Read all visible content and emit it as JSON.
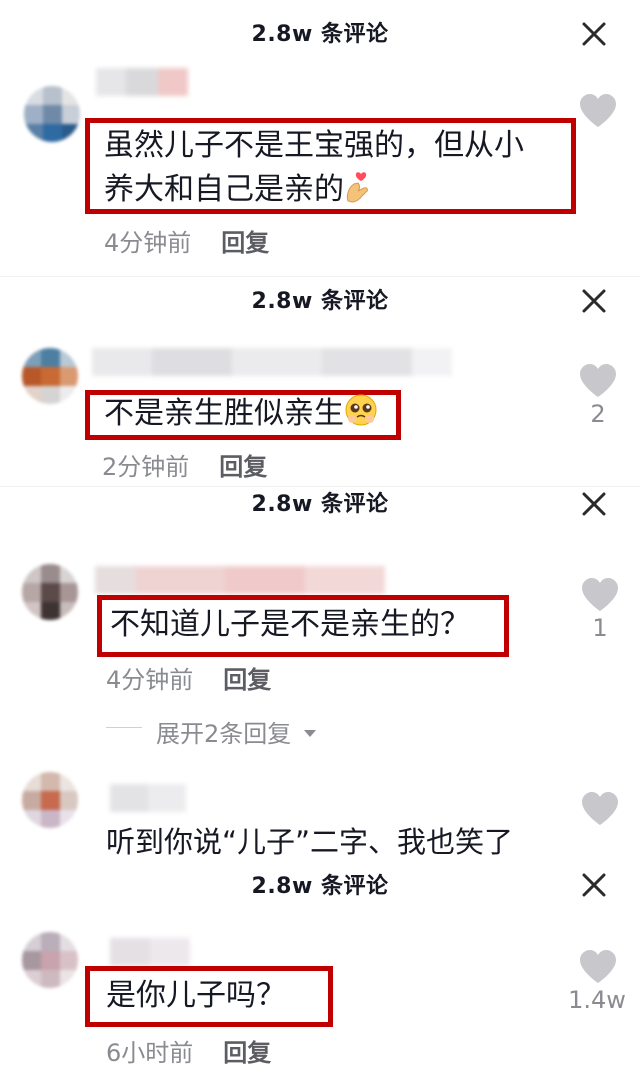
{
  "panels": [
    {
      "header": "2.8w 条评论",
      "comment_line1": "虽然儿子不是王宝强的，但从小",
      "comment_line2": "养大和自己是亲的",
      "emoji": "finger-heart",
      "time": "4分钟前",
      "reply": "回复",
      "likes": ""
    },
    {
      "header": "2.8w 条评论",
      "comment": "不是亲生胜似亲生",
      "emoji": "pleading-face",
      "time": "2分钟前",
      "reply": "回复",
      "likes": "2"
    },
    {
      "header": "2.8w 条评论",
      "comment": "不知道儿子是不是亲生的？",
      "time": "4分钟前",
      "reply": "回复",
      "likes": "1",
      "expand": "展开2条回复",
      "sub_comment": "听到你说“儿子”二字、我也笑了"
    },
    {
      "header": "2.8w 条评论",
      "comment": "是你儿子吗？",
      "time": "6小时前",
      "reply": "回复",
      "likes": "1.4w"
    }
  ],
  "colors": {
    "highlight_box": "#c00000",
    "text": "#161823",
    "muted": "#8a8b91",
    "heart": "#c7c7cc"
  }
}
